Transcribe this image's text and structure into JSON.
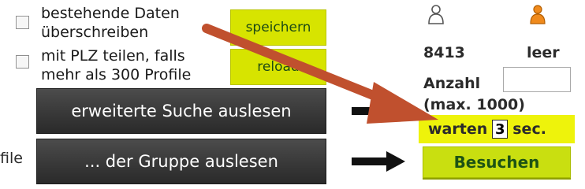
{
  "options": {
    "overwrite_label_line1": "bestehende Daten",
    "overwrite_label_line2": "überschreiben",
    "share_label_line1": "mit PLZ teilen, falls",
    "share_label_line2": "mehr als 300 Profile"
  },
  "buttons": {
    "save": "speichern",
    "reload": "reload",
    "read_search": "erweiterte Suche auslesen",
    "read_group": "... der Gruppe auslesen",
    "visit": "Besuchen"
  },
  "left_cut_label": "file",
  "stats": {
    "count": "8413",
    "empty": "leer"
  },
  "amount": {
    "label": "Anzahl",
    "hint": "(max. 1000)",
    "value": ""
  },
  "wait": {
    "prefix": "warten",
    "value": "3",
    "suffix": "sec."
  },
  "colors": {
    "accent_green": "#d7e400",
    "wait_highlight": "#eef30b",
    "annotation_arrow": "#c0502e",
    "dark_button": "#3a3a3a"
  },
  "icons": [
    "user-gray-icon",
    "user-orange-icon",
    "arrow-right-icon",
    "annotation-arrow"
  ]
}
